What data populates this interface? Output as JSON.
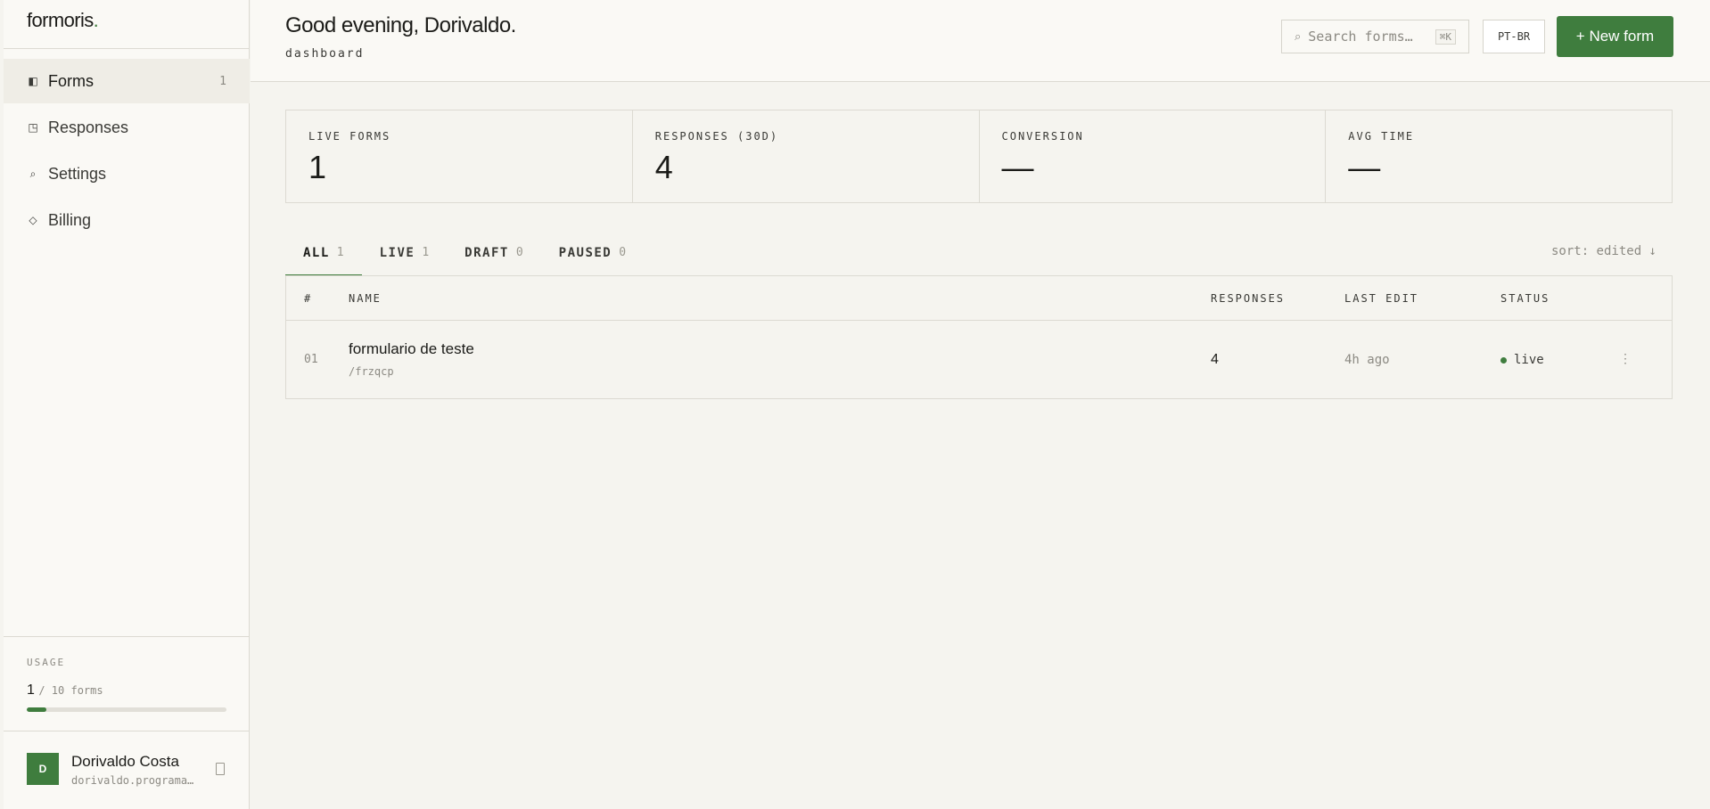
{
  "app": {
    "logo_text": "formoris",
    "logo_dot": "."
  },
  "sidebar": {
    "items": [
      {
        "label": "Forms",
        "icon": "forms-icon",
        "glyph": "◧",
        "count": "1",
        "active": true
      },
      {
        "label": "Responses",
        "icon": "responses-icon",
        "glyph": "◳"
      },
      {
        "label": "Settings",
        "icon": "settings-icon",
        "glyph": "⌕"
      },
      {
        "label": "Billing",
        "icon": "billing-icon",
        "glyph": "◇"
      }
    ],
    "usage": {
      "title": "USAGE",
      "used": "1",
      "limit_text": "/ 10 forms",
      "fraction": 0.1
    },
    "user": {
      "avatar_letter": "D",
      "name": "Dorivaldo Costa",
      "email": "dorivaldo.programa…"
    }
  },
  "header": {
    "greeting": "Good evening, Dorivaldo.",
    "breadcrumb": "dashboard",
    "search": {
      "icon": "search-icon",
      "glyph": "⌕",
      "placeholder": "Search forms…",
      "shortcut": "⌘K"
    },
    "language_label": "PT-BR",
    "new_form_label": "+ New form"
  },
  "stats": [
    {
      "label": "LIVE FORMS",
      "value": "1"
    },
    {
      "label": "RESPONSES (30D)",
      "value": "4"
    },
    {
      "label": "CONVERSION",
      "value": "—"
    },
    {
      "label": "AVG TIME",
      "value": "—"
    }
  ],
  "tabs": [
    {
      "label": "ALL",
      "count": "1",
      "active": true
    },
    {
      "label": "LIVE",
      "count": "1"
    },
    {
      "label": "DRAFT",
      "count": "0"
    },
    {
      "label": "PAUSED",
      "count": "0"
    }
  ],
  "sort_label": "sort: edited ↓",
  "table": {
    "headers": {
      "index": "#",
      "name": "NAME",
      "responses": "RESPONSES",
      "last_edit": "LAST EDIT",
      "status": "STATUS"
    },
    "rows": [
      {
        "index": "01",
        "name": "formulario de teste",
        "slug": "/frzqcp",
        "responses": "4",
        "last_edit": "4h ago",
        "status": "live",
        "status_color": "#3f7d3e",
        "more_glyph": "⋮"
      }
    ]
  },
  "colors": {
    "accent": "#3f7d3e",
    "background": "#f5f4ef",
    "surface": "#faf9f5",
    "border": "#dcdad2"
  }
}
